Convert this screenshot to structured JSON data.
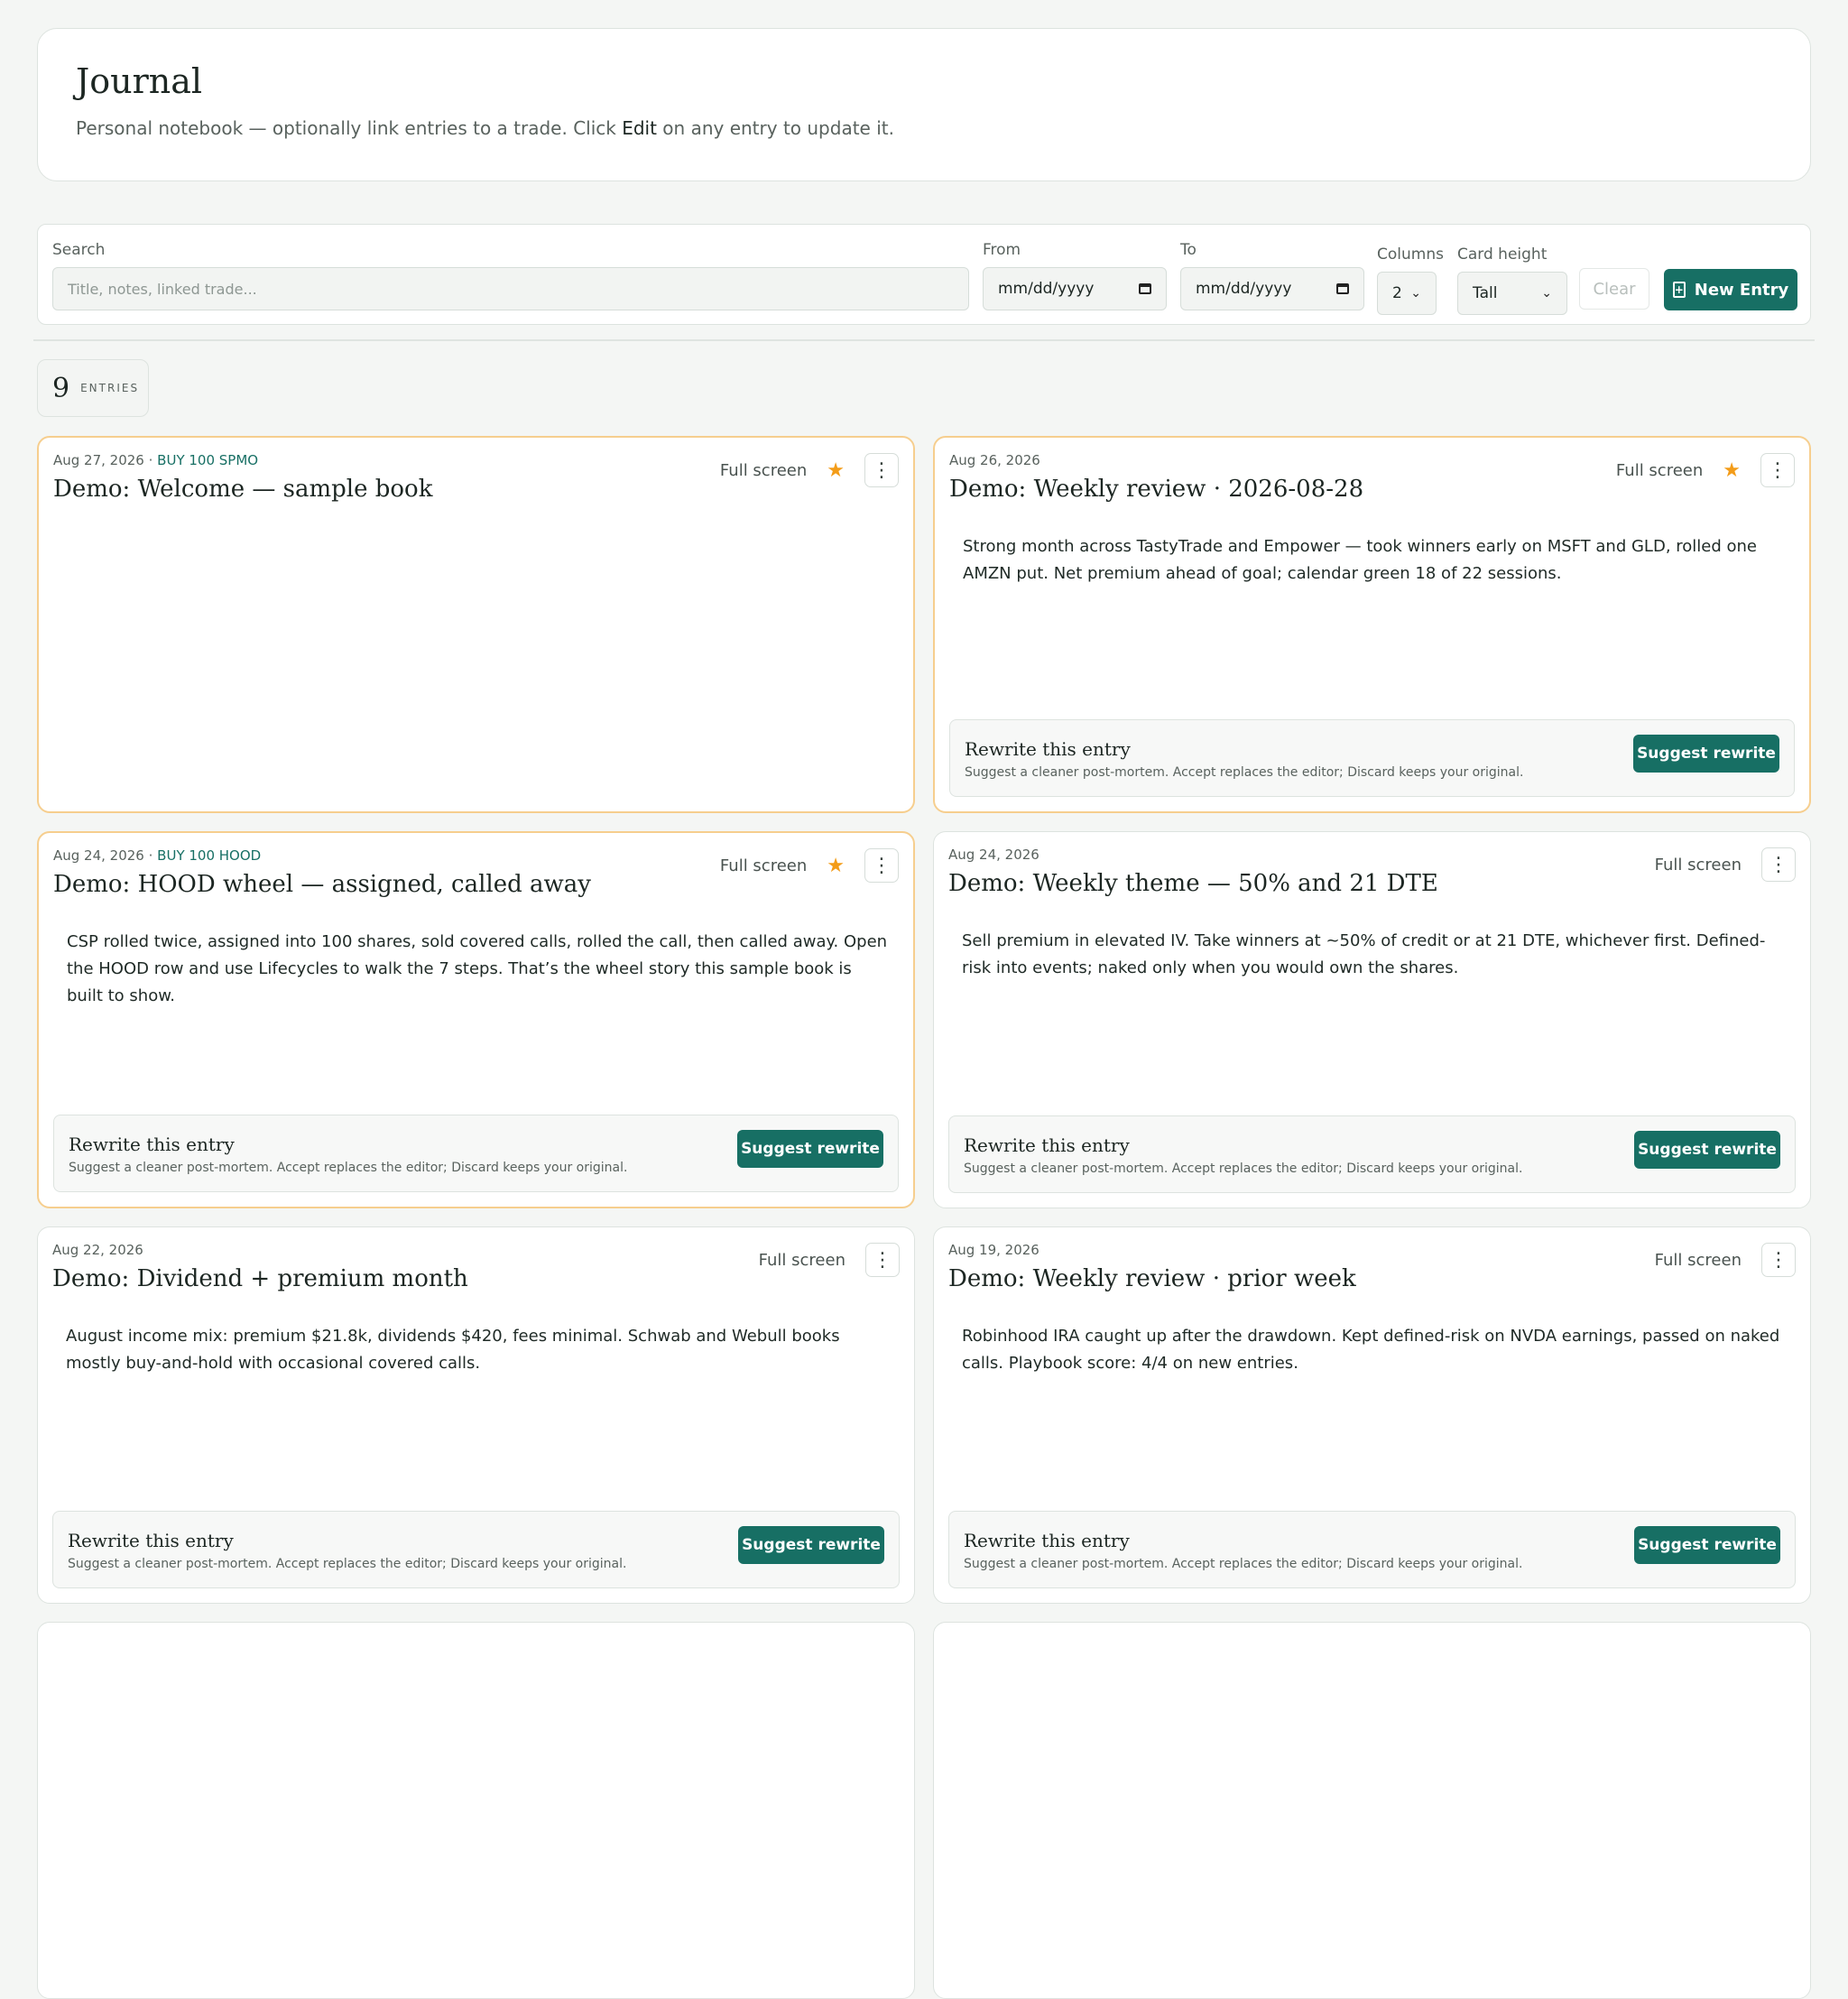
{
  "header": {
    "title": "Journal",
    "subtitle_before": "Personal notebook — optionally link entries to a trade. Click ",
    "subtitle_edit": "Edit",
    "subtitle_after": " on any entry to update it."
  },
  "toolbar": {
    "search_label": "Search",
    "search_placeholder": "Title, notes, linked trade...",
    "from_label": "From",
    "from_value": "mm/dd/yyyy",
    "to_label": "To",
    "to_value": "mm/dd/yyyy",
    "columns_label": "Columns",
    "columns_value": "2",
    "card_height_label": "Card height",
    "card_height_value": "Tall",
    "clear_label": "Clear",
    "new_entry_label": "New Entry"
  },
  "count": {
    "value": "9",
    "label": "ENTRIES"
  },
  "card_common": {
    "full_screen": "Full screen",
    "rewrite_title": "Rewrite this entry",
    "rewrite_desc": "Suggest a cleaner post-mortem. Accept replaces the editor; Discard keeps your original.",
    "suggest_label": "Suggest rewrite",
    "star_glyph": "★",
    "kebab_glyph": "⋮"
  },
  "entries": [
    {
      "date": "Aug 27, 2026",
      "trade": "BUY 100 SPMO",
      "title": "Demo: Welcome — sample book",
      "body": "",
      "starred": true,
      "rewrite": false
    },
    {
      "date": "Aug 26, 2026",
      "trade": "",
      "title": "Demo: Weekly review · 2026-08-28",
      "body": "Strong month across TastyTrade and Empower — took winners early on MSFT and GLD, rolled one AMZN put. Net premium ahead of goal; calendar green 18 of 22 sessions.",
      "starred": true,
      "rewrite": true
    },
    {
      "date": "Aug 24, 2026",
      "trade": "BUY 100 HOOD",
      "title": "Demo: HOOD wheel — assigned, called away",
      "body": "CSP rolled twice, assigned into 100 shares, sold covered calls, rolled the call, then called away. Open the HOOD row and use Lifecycles to walk the 7 steps. That’s the wheel story this sample book is built to show.",
      "starred": true,
      "rewrite": true
    },
    {
      "date": "Aug 24, 2026",
      "trade": "",
      "title": "Demo: Weekly theme — 50% and 21 DTE",
      "body": "Sell premium in elevated IV. Take winners at ~50% of credit or at 21 DTE, whichever first. Defined-risk into events; naked only when you would own the shares.",
      "starred": false,
      "rewrite": true
    },
    {
      "date": "Aug 22, 2026",
      "trade": "",
      "title": "Demo: Dividend + premium month",
      "body": "August income mix: premium $21.8k, dividends $420, fees minimal. Schwab and Webull books mostly buy-and-hold with occasional covered calls.",
      "starred": false,
      "rewrite": true
    },
    {
      "date": "Aug 19, 2026",
      "trade": "",
      "title": "Demo: Weekly review · prior week",
      "body": "Robinhood IRA caught up after the drawdown. Kept defined-risk on NVDA earnings, passed on naked calls. Playbook score: 4/4 on new entries.",
      "starred": false,
      "rewrite": true
    }
  ],
  "colors": {
    "accent": "#176f64",
    "star": "#f39c18",
    "starred_border": "#f6ce8e"
  }
}
